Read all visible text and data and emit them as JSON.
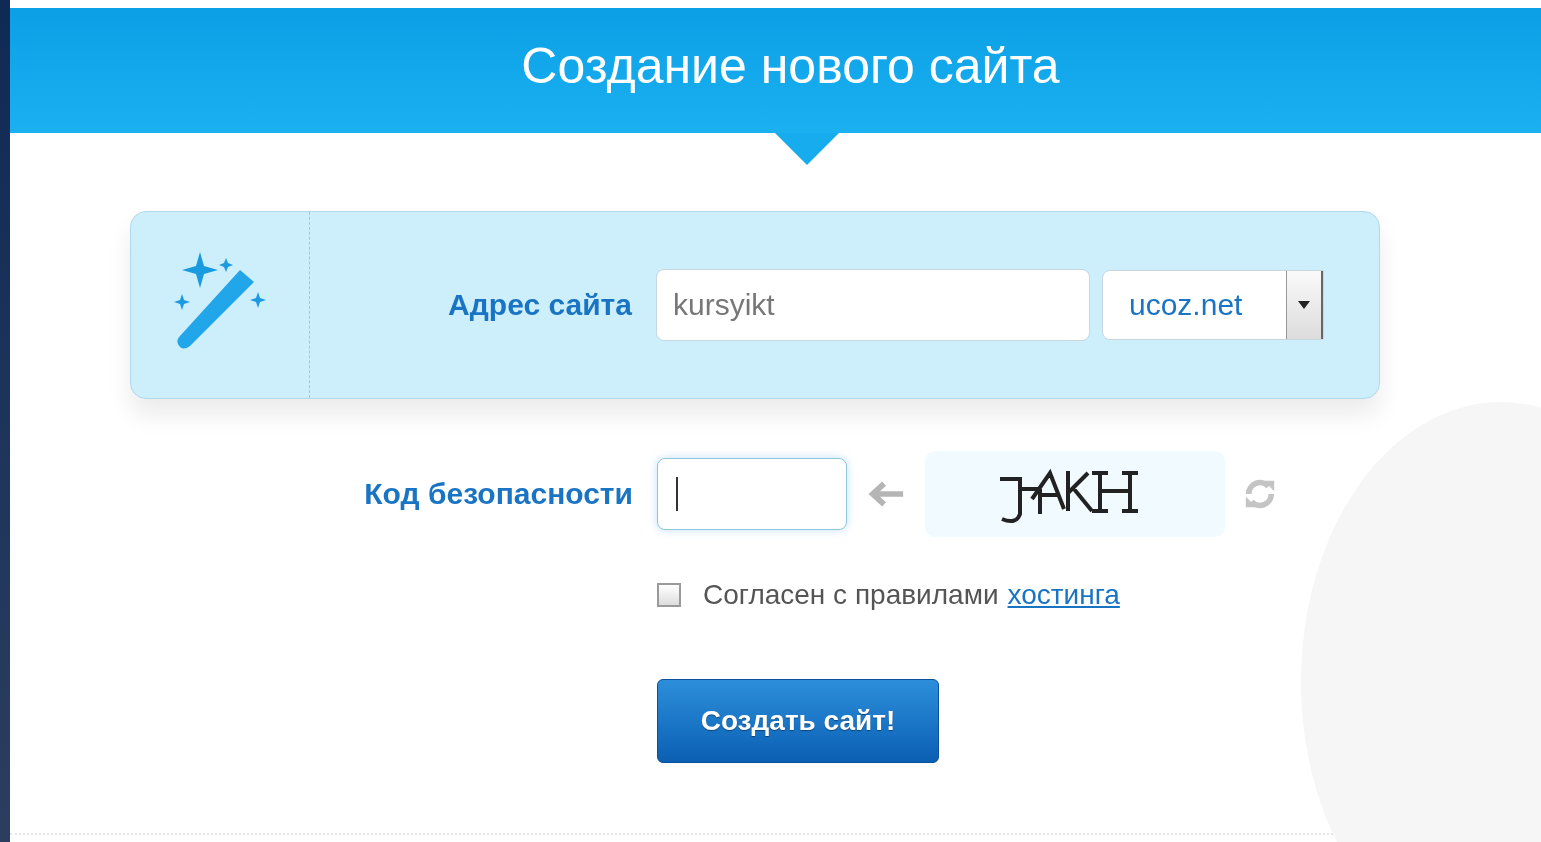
{
  "header": {
    "title": "Создание нового сайта"
  },
  "address": {
    "label": "Адрес сайта",
    "value": "kursyikt",
    "domain": "ucoz.net"
  },
  "security": {
    "label": "Код безопасности",
    "focused": true
  },
  "agree": {
    "checked": false,
    "text": "Согласен с правилами",
    "link": "хостинга"
  },
  "submit": {
    "label": "Создать сайт!"
  }
}
